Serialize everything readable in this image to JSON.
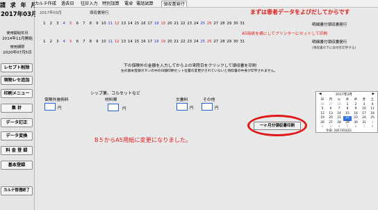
{
  "sidebar": {
    "brand": "請 求 年 月",
    "year_month": "2017年03月",
    "start_label": "使用開始年月",
    "start_value": "2014年11月開始",
    "period_label": "使用期限",
    "period_value": "2020年07月5日",
    "buttons": [
      "レセプト削除",
      "現物レセ追加",
      "印刷メニュー",
      "集 計",
      "データ訂正",
      "データ変換",
      "料 金 登 録",
      "基本登録",
      "カルテ管理終了"
    ]
  },
  "tabs": [
    "カルテ作成",
    "過去日",
    "往診入力",
    "特別加算",
    "電卓",
    "電話試算",
    "領収書発行"
  ],
  "main": {
    "subtitle_ym": "2017年03月",
    "subtitle_title": "領収書発行",
    "banner": "まずは患者データをよびだしてからです",
    "a5_note": "A5用紙を横にしてプリンターにセットして印刷",
    "days_row1": [
      "1",
      "2",
      "3",
      "4",
      "5",
      "6",
      "7",
      "8",
      "9",
      "10",
      "11",
      "12",
      "13",
      "14",
      "15",
      "16",
      "17",
      "18",
      "19",
      "20",
      "21",
      "22",
      "23",
      "24",
      "25",
      "26",
      "27",
      "28",
      "29",
      "30",
      "31"
    ],
    "days_row2": [
      "1",
      "2",
      "3",
      "4",
      "5",
      "6",
      "7",
      "8",
      "9",
      "10",
      "11",
      "12",
      "13",
      "14",
      "15",
      "16",
      "17",
      "18",
      "19",
      "20",
      "21",
      "22",
      "23",
      "24",
      "25",
      "26",
      "27",
      "28",
      "29",
      "30",
      "31"
    ],
    "row1_label": "明細書付領収書発行",
    "row2_label": "明細書付領収書発行",
    "row2_sublabel": "(領収書の下に日付を印字する)",
    "instruction1": "下の保険外の金額を入力してから上の来院日をクリックして領収書を印刷",
    "instruction2": "左の基本登録ボタンの中の日額印刷セット位置の変更がされていないと領収書の中身が印字されません。",
    "misc_label": "シップ薬、コルセットなど",
    "fields": [
      {
        "label": "保険外施術料",
        "unit": "円"
      },
      {
        "label": "材料費",
        "unit": "円"
      },
      {
        "label": "文書料",
        "unit": "円"
      },
      {
        "label": "その他",
        "unit": "円"
      }
    ],
    "print_button": "一ヶ月分領収書印刷",
    "b5_note": "B５からA5用紙に変更になりました。"
  },
  "calendar": {
    "title": "2017年3月",
    "prev": "◀",
    "next": "▶",
    "weekdays": [
      "日",
      "月",
      "火",
      "水",
      "木",
      "金",
      "土"
    ],
    "cells": [
      "26",
      "27",
      "28",
      "1",
      "2",
      "3",
      "4",
      "5",
      "6",
      "7",
      "8",
      "9",
      "10",
      "11",
      "12",
      "13",
      "14",
      "15",
      "16",
      "17",
      "18",
      "19",
      "20",
      "21",
      "22",
      "23",
      "24",
      "25",
      "26",
      "27",
      "28",
      "29",
      "30",
      "31",
      "1",
      "2",
      "3",
      "4",
      "5",
      "6",
      "7",
      "8"
    ],
    "today_label": "今日: 2017/03/22"
  },
  "colors": {
    "accent_red": "#e01818",
    "saturday": "#2030d0",
    "sunday": "#d02020",
    "input_border": "#2060d0"
  }
}
